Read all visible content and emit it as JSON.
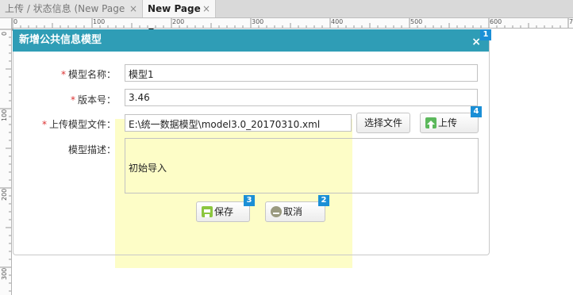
{
  "tabs": [
    {
      "label": "上传 / 状态信息 (New Page 1)",
      "close": "×"
    },
    {
      "label": "New Page 1",
      "close": "×"
    }
  ],
  "ruler": {
    "top_labels": [
      "0",
      "100",
      "200",
      "300",
      "400",
      "500",
      "600",
      "7"
    ],
    "left_labels": [
      "0",
      "100",
      "200",
      "300"
    ]
  },
  "dialog": {
    "title": "新增公共信息模型",
    "close_glyph": "×",
    "fields": {
      "model_name": {
        "label": "模型名称：",
        "value": "模型1",
        "required": "*"
      },
      "version": {
        "label": "版本号：",
        "value": "3.46",
        "required": "*"
      },
      "upload": {
        "label": "上传模型文件：",
        "value": "E:\\统一数据模型\\model3.0_20170310.xml",
        "required": "*"
      },
      "description": {
        "label": "模型描述：",
        "value": "初始导入"
      }
    },
    "buttons": {
      "select_file": "选择文件",
      "upload": "上传",
      "save": "保存",
      "cancel": "取消"
    }
  },
  "badges": {
    "close": "1",
    "cancel": "2",
    "save": "3",
    "upload": "4"
  },
  "colors": {
    "header": "#2f9db6",
    "badge": "#1b8fd6",
    "required": "#dd3333",
    "guide_yellow": "#fdfdc7",
    "upload_icon": "#5cb85c",
    "save_icon": "#8cc63f",
    "cancel_icon": "#9a9a80"
  },
  "icons": {
    "upload": "upload-arrow-icon",
    "save": "floppy-disk-icon",
    "cancel": "minus-circle-icon"
  }
}
